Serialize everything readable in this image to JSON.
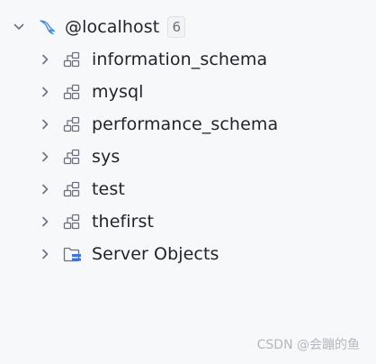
{
  "tree": {
    "root": {
      "label": "@localhost",
      "count": "6",
      "icon": "mysql-dolphin-icon",
      "expanded": true
    },
    "children": [
      {
        "label": "information_schema",
        "icon": "schema-icon"
      },
      {
        "label": "mysql",
        "icon": "schema-icon"
      },
      {
        "label": "performance_schema",
        "icon": "schema-icon"
      },
      {
        "label": "sys",
        "icon": "schema-icon"
      },
      {
        "label": "test",
        "icon": "schema-icon"
      },
      {
        "label": "thefirst",
        "icon": "schema-icon"
      },
      {
        "label": "Server Objects",
        "icon": "server-objects-folder-icon"
      }
    ]
  },
  "watermark": "CSDN @会蹦的鱼",
  "colors": {
    "background": "#f7f8fa",
    "text": "#1f2328",
    "chevron": "#6c707e",
    "icon_stroke": "#6c707e",
    "dolphin": "#3d8ae6",
    "folder_accent": "#3574f0"
  }
}
